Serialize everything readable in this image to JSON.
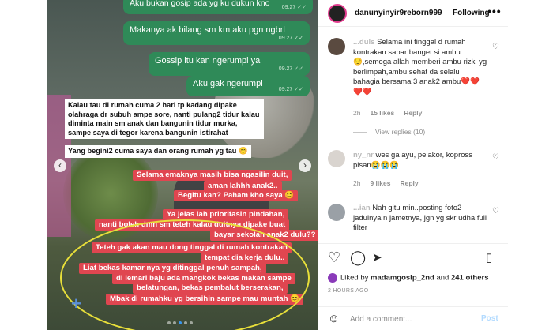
{
  "post": {
    "username": "danunyinyir9reborn999",
    "follow_label": "Following",
    "more_label": "•••"
  },
  "chat": {
    "bubbles": [
      {
        "text": "Aku bukan gosip ada yg ku dukun kno",
        "time": "09.27 ✓✓"
      },
      {
        "text": "Makanya ak bilang sm km aku pgn ngbrl",
        "time": "09.27 ✓✓"
      },
      {
        "text": "Gossip itu kan ngerumpi ya",
        "time": "09.27 ✓✓"
      },
      {
        "text": "Aku gak ngerumpi",
        "time": "09.27 ✓✓"
      }
    ],
    "white_note": "Kalau tau di rumah cuma 2 hari tp kadang dipake olahraga dr subuh ampe sore, nanti pulang2 tidur kalau diminta main sm anak dan bangunin tidur murka, sampe saya di tegor karena bangunin istirahat",
    "white_note2": "Yang begini2 cuma saya dan orang rumah yg tau 😊",
    "red_lines": [
      "Selama emaknya masih bisa ngasilin duit,",
      "aman lahhh anak2..",
      "Begitu kan? Paham kho saya 😊",
      "Ya jelas lah prioritasin pindahan,",
      "nanti boleh dmn sm teteh kalau duitnya dipake buat",
      "bayar sekolah anak2 dulu??",
      "Teteh gak akan mau dong tinggal di rumah kontrakan",
      "tempat dia kerja dulu..",
      "Liat bekas kamar nya yg ditinggal penuh sampah,",
      "di lemari baju ada mangkok bekas makan sampe",
      "belatungan, bekas pembalut berserakan,",
      "Mbak di rumahku yg bersihin sampe mau muntah 😊"
    ],
    "nav_prev": "‹",
    "nav_next": "›",
    "plus_icon": "+"
  },
  "comments": [
    {
      "username": "...duls",
      "text": "Selama ini tinggal d rumah kontrakan sabar banget si ambu😔,semoga allah memberi ambu rizki yg berlimpah,ambu sehat da selalu bahagia bersama 3 anak2 ambu❤️❤️❤️❤️",
      "age": "2h",
      "likes": "15 likes",
      "reply": "Reply",
      "view_replies": "View replies (10)"
    },
    {
      "username": "ny_nr",
      "text": "wes ga ayu, pelakor, kopross pisan😭😭😭",
      "age": "2h",
      "likes": "9 likes",
      "reply": "Reply"
    },
    {
      "username": "...ian",
      "text": "Nah gitu min..posting foto2 jadulnya n jametnya, jgn yg skr udha full filter",
      "age": "",
      "likes": "",
      "reply": ""
    }
  ],
  "actions": {
    "liked_by_prefix": "Liked by ",
    "liked_user": "madamgosip_2nd",
    "liked_and": " and ",
    "liked_others": "241 others",
    "time_ago": "2 HOURS AGO"
  },
  "add_comment": {
    "placeholder": "Add a comment...",
    "post_label": "Post"
  }
}
